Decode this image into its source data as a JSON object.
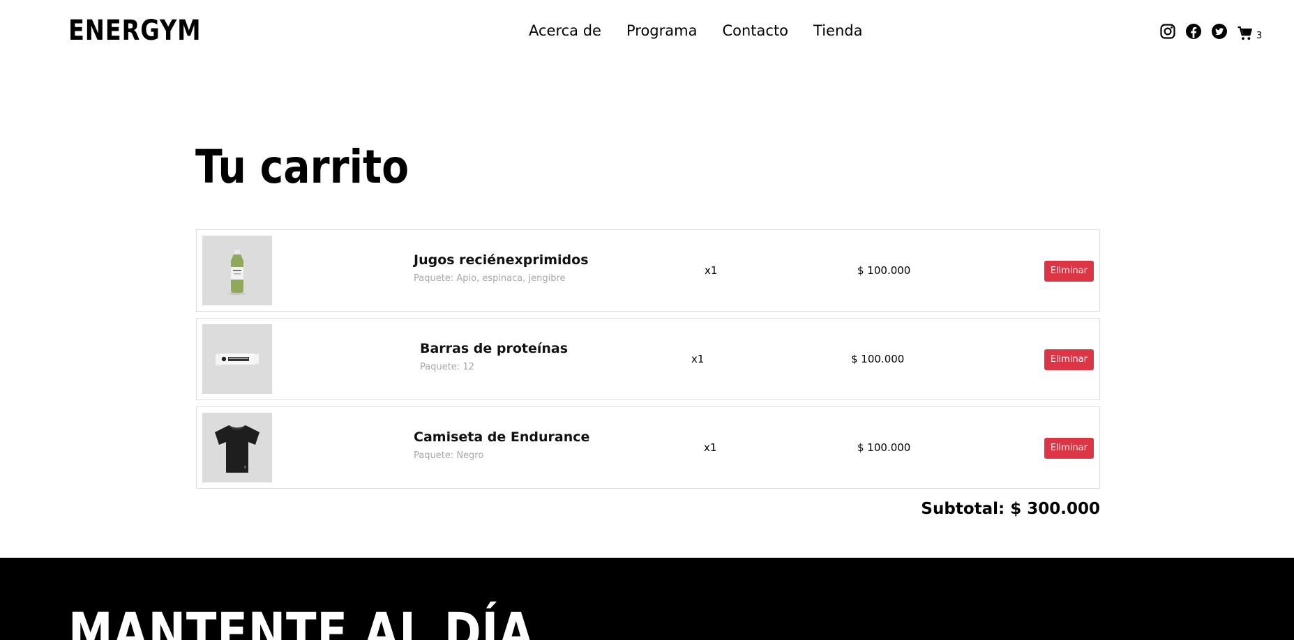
{
  "header": {
    "logo": "ENERGYM",
    "nav": [
      "Acerca de",
      "Programa",
      "Contacto",
      "Tienda"
    ],
    "social_icons": [
      "instagram-icon",
      "facebook-icon",
      "twitter-icon"
    ],
    "cart_icon": "cart-icon",
    "cart_count": "3"
  },
  "page": {
    "title": "Tu carrito"
  },
  "cart": {
    "items": [
      {
        "name": "Jugos reciénexprimidos",
        "detail": "Paquete: Apio, espinaca, jengibre",
        "quantity": "x1",
        "price": "$ 100.000",
        "remove_label": "Eliminar",
        "image": "juice-bottle"
      },
      {
        "name": "Barras de proteínas",
        "detail": "Paquete: 12",
        "quantity": "x1",
        "price": "$ 100.000",
        "remove_label": "Eliminar",
        "image": "protein-bar"
      },
      {
        "name": "Camiseta de Endurance",
        "detail": "Paquete: Negro",
        "quantity": "x1",
        "price": "$ 100.000",
        "remove_label": "Eliminar",
        "image": "black-tshirt"
      }
    ],
    "subtotal": "Subtotal: $ 300.000"
  },
  "footer": {
    "title": "MANTENTE AL DÍA"
  },
  "colors": {
    "accent": "#dc3545",
    "footer_bg": "#000000",
    "thumb_bg": "#dcdcdc"
  }
}
